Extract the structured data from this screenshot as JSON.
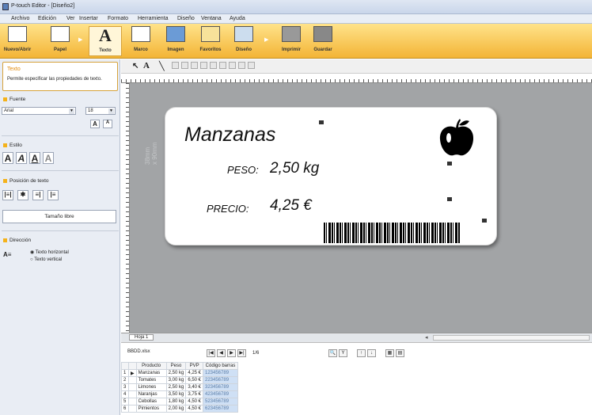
{
  "window": {
    "title": "P-touch Editor - [Diseño2]"
  },
  "menu": [
    "Archivo",
    "Edición",
    "Ver",
    "Insertar",
    "Formato",
    "Herramienta",
    "Diseño",
    "Ventana",
    "Ayuda"
  ],
  "ribbon": {
    "buttons": [
      "Nuevo/Abrir",
      "Papel",
      "Texto",
      "Marco",
      "Imagen",
      "Favoritos",
      "Diseño",
      "Imprimir",
      "Guardar"
    ]
  },
  "panel": {
    "header": "Texto",
    "description": "Permite especificar las propiedades de texto.",
    "font_section": "Fuente",
    "font_value": "Arial",
    "size_value": "18",
    "style_section": "Estilo",
    "pos_section": "Posición de texto",
    "size_label": "Tamaño libre",
    "dir_section": "Dirección",
    "dir_h": "Texto horizontal",
    "dir_v": "Texto vertical"
  },
  "label": {
    "title": "Manzanas",
    "peso_label": "PESO:",
    "peso_value": "2,50 kg",
    "precio_label": "PRECIO:",
    "precio_value": "4,25 €",
    "dimension": "38mm\nx 90mm"
  },
  "sheet": {
    "tab": "Hoja 1"
  },
  "database": {
    "file": "BBDD.xlsx",
    "page": "1/6",
    "headers": [
      "",
      "",
      "Producto",
      "Peso",
      "PVP",
      "Código barras"
    ],
    "rows": [
      [
        "1",
        "▶",
        "Manzanas",
        "2,50 kg",
        "4,25 €",
        "123456789"
      ],
      [
        "2",
        "",
        "Tomates",
        "3,00 kg",
        "6,50 €",
        "223456789"
      ],
      [
        "3",
        "",
        "Limones",
        "2,50 kg",
        "3,40 €",
        "323456789"
      ],
      [
        "4",
        "",
        "Naranjas",
        "3,50 kg",
        "3,75 €",
        "423456789"
      ],
      [
        "5",
        "",
        "Cebollas",
        "1,80 kg",
        "4,50 €",
        "523456789"
      ],
      [
        "6",
        "",
        "Pimientos",
        "2,00 kg",
        "4,50 €",
        "623456789"
      ]
    ]
  },
  "colors": {
    "accent": "#f4b21b",
    "ribbon": "#f3b436",
    "canvas": "#a2a4a6"
  }
}
